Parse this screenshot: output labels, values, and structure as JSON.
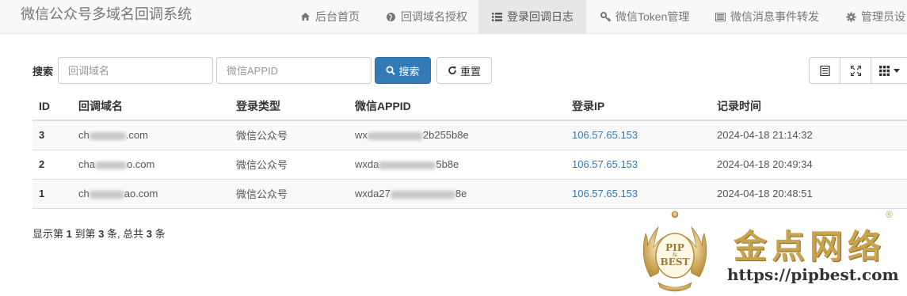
{
  "app": {
    "title": "微信公众号多域名回调系统"
  },
  "nav": [
    {
      "label": "后台首页",
      "icon": "home-icon"
    },
    {
      "label": "回调域名授权",
      "icon": "globe-icon"
    },
    {
      "label": "登录回调日志",
      "icon": "list-icon",
      "active": true
    },
    {
      "label": "微信Token管理",
      "icon": "key-icon"
    },
    {
      "label": "微信消息事件转发",
      "icon": "tasks-icon"
    },
    {
      "label": "管理员设",
      "icon": "gear-icon"
    }
  ],
  "toolbar": {
    "search_label": "搜索",
    "domain_placeholder": "回调域名",
    "appid_placeholder": "微信APPID",
    "search_button": "搜索",
    "reset_button": "重置"
  },
  "table": {
    "columns": [
      "ID",
      "回调域名",
      "登录类型",
      "微信APPID",
      "登录IP",
      "记录时间"
    ],
    "rows": [
      {
        "id": "3",
        "domain_start": "ch",
        "domain_end": ".com",
        "type": "微信公众号",
        "appid_start": "wx",
        "appid_end": "2b255b8e",
        "ip": "106.57.65.153",
        "time": "2024-04-18 21:14:32"
      },
      {
        "id": "2",
        "domain_start": "cha",
        "domain_end": "o.com",
        "type": "微信公众号",
        "appid_start": "wxda",
        "appid_end": "5b8e",
        "ip": "106.57.65.153",
        "time": "2024-04-18 20:49:34"
      },
      {
        "id": "1",
        "domain_start": "ch",
        "domain_end": "ao.com",
        "type": "微信公众号",
        "appid_start": "wxda27",
        "appid_end": "8e",
        "ip": "106.57.65.153",
        "time": "2024-04-18 20:48:51"
      }
    ]
  },
  "pagination": {
    "prefix": "显示第 ",
    "from": "1",
    "mid1": " 到第 ",
    "to": "3",
    "mid2": " 条, 总共 ",
    "total": "3",
    "suffix": " 条"
  },
  "watermark": {
    "seal_top": "PIP",
    "seal_mid": "&",
    "seal_bottom": "BEST",
    "brand": "金点网络",
    "url": "https://pipbest.com",
    "registered": "®"
  },
  "colors": {
    "primary": "#337ab7",
    "link": "#337ab7",
    "gold": "#c8a24c"
  }
}
